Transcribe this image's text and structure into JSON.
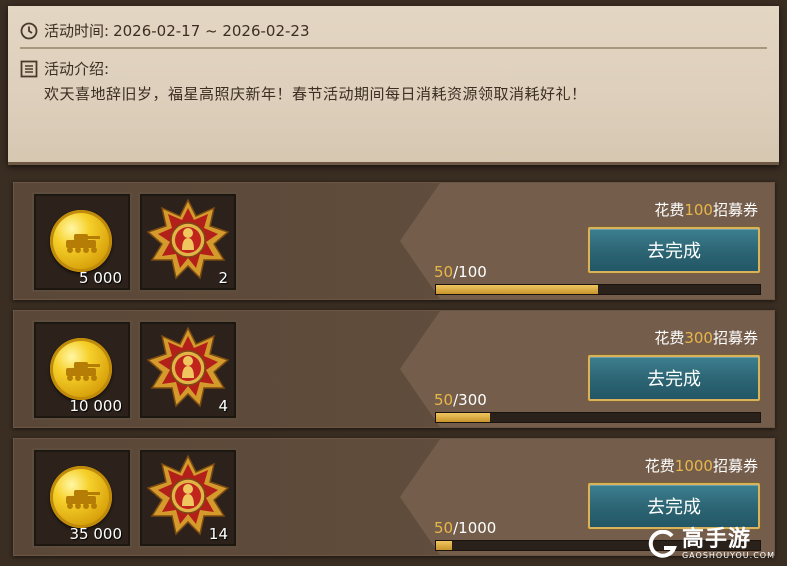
{
  "event": {
    "time_label": "活动时间:",
    "time_value": "2026-02-17 ~ 2026-02-23",
    "intro_label": "活动介绍:",
    "intro_text": "欢天喜地辞旧岁，福星高照庆新年！春节活动期间每日消耗资源领取消耗好礼！"
  },
  "tasks": [
    {
      "coin_count": "5 000",
      "medal_count": "2",
      "cost_prefix": "花费",
      "cost_value": "100",
      "cost_suffix": "招募券",
      "button_label": "去完成",
      "progress_current": "50",
      "progress_total": "/100",
      "progress_fraction": 0.5
    },
    {
      "coin_count": "10 000",
      "medal_count": "4",
      "cost_prefix": "花费",
      "cost_value": "300",
      "cost_suffix": "招募券",
      "button_label": "去完成",
      "progress_current": "50",
      "progress_total": "/300",
      "progress_fraction": 0.1667
    },
    {
      "coin_count": "35 000",
      "medal_count": "14",
      "cost_prefix": "花费",
      "cost_value": "1000",
      "cost_suffix": "招募券",
      "button_label": "去完成",
      "progress_current": "50",
      "progress_total": "/1000",
      "progress_fraction": 0.05
    }
  ],
  "watermark": {
    "title": "高手游",
    "subtitle": "GAOSHOUYOU.COM"
  },
  "colors": {
    "accent_gold": "#e9b64a",
    "button_teal": "#2c6473"
  }
}
